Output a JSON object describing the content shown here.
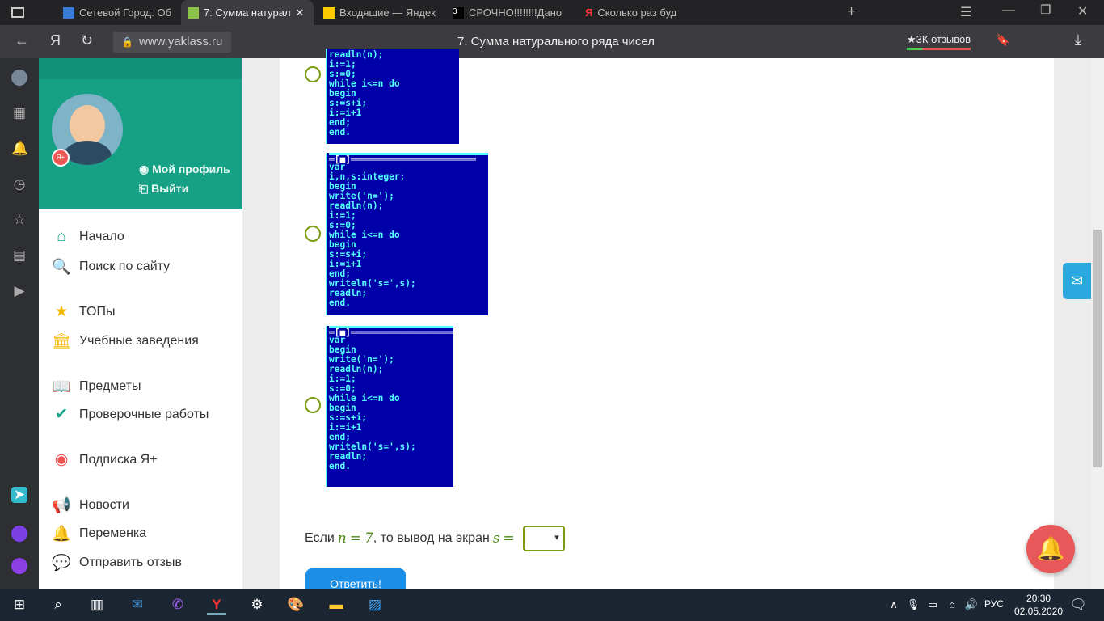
{
  "browser": {
    "tabs": [
      {
        "label": "Сетевой Город. Об",
        "active": false
      },
      {
        "label": "7. Сумма натурал",
        "active": true
      },
      {
        "label": "Входящие — Яндек",
        "active": false
      },
      {
        "label": "СРОЧНО!!!!!!!!Дано",
        "active": false
      },
      {
        "label": "Сколько раз буд",
        "active": false
      }
    ],
    "url": "www.yaklass.ru",
    "page_title": "7. Сумма натурального ряда чисел",
    "reviews": "★3К отзывов"
  },
  "profile": {
    "my_profile": "Мой профиль",
    "logout": "Выйти",
    "badge": "Я+"
  },
  "menu": [
    {
      "label": "Начало",
      "icon": "home-icon"
    },
    {
      "label": "Поиск по сайту",
      "icon": "search-icon"
    },
    {
      "label": "ТОПы",
      "icon": "star-icon"
    },
    {
      "label": "Учебные заведения",
      "icon": "institution-icon"
    },
    {
      "label": "Предметы",
      "icon": "book-icon"
    },
    {
      "label": "Проверочные работы",
      "icon": "check-icon"
    },
    {
      "label": "Подписка Я+",
      "icon": "subscription-icon"
    },
    {
      "label": "Новости",
      "icon": "megaphone-icon"
    },
    {
      "label": "Переменка",
      "icon": "bell-icon"
    },
    {
      "label": "Отправить отзыв",
      "icon": "comment-icon"
    }
  ],
  "options": [
    {
      "header": "",
      "code": "readln(n);\ni:=1;\ns:=0;\nwhile i<=n do\nbegin\ns:=s+i;\ni:=i+1\nend;\nend."
    },
    {
      "header": "═[■]═══════════════════════",
      "code": "var\ni,n,s:integer;\nbegin\nwrite('n=');\nreadln(n);\ni:=1;\ns:=0;\nwhile i<=n do\nbegin\ns:=s+i;\ni:=i+1\nend;\nwriteln('s=',s);\nreadln;\nend."
    },
    {
      "header": "═[■]═══════════════════",
      "code": "var\nbegin\nwrite('n=');\nreadln(n);\ni:=1;\ns:=0;\nwhile i<=n do\nbegin\ns:=s+i;\ni:=i+1\nend;\nwriteln('s=',s);\nreadln;\nend."
    }
  ],
  "question": {
    "prefix": "Если",
    "var_n": "n",
    "eq": "=",
    "n_value": "7",
    "middle": ", то вывод на экран",
    "var_s": "s",
    "eq2": "=",
    "selected": ""
  },
  "answer_button": "Ответить!",
  "taskbar": {
    "lang": "РУС",
    "time": "20:30",
    "date": "02.05.2020"
  }
}
